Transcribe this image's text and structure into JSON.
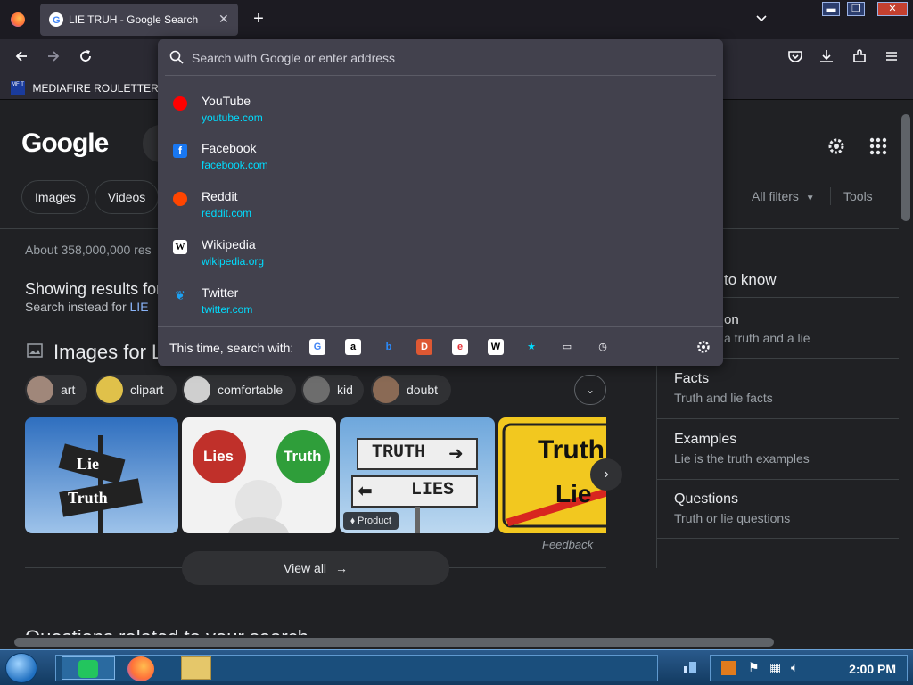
{
  "browser": {
    "tab_title": "LIE TRUH - Google Search",
    "new_tab": "+",
    "tab_close": "✕",
    "list_tabs": "⌄",
    "bookmark": "MEDIAFIRE ROULETTER",
    "bookmark_badge": "MF T"
  },
  "urlbar": {
    "placeholder": "Search with Google or enter address",
    "suggestions": [
      {
        "name": "YouTube",
        "url": "youtube.com",
        "icon": "youtube-icon",
        "color": "#ff0000"
      },
      {
        "name": "Facebook",
        "url": "facebook.com",
        "icon": "facebook-icon",
        "color": "#1877f2"
      },
      {
        "name": "Reddit",
        "url": "reddit.com",
        "icon": "reddit-icon",
        "color": "#ff4500"
      },
      {
        "name": "Wikipedia",
        "url": "wikipedia.org",
        "icon": "wikipedia-icon",
        "color": "#ffffff"
      },
      {
        "name": "Twitter",
        "url": "twitter.com",
        "icon": "twitter-icon",
        "color": "#1da1f2"
      }
    ],
    "search_with_label": "This time, search with:",
    "engines": [
      {
        "name": "google-engine-icon",
        "glyph": "G",
        "bg": "#ffffff",
        "fg": "#4285f4"
      },
      {
        "name": "amazon-engine-icon",
        "glyph": "a",
        "bg": "#ffffff",
        "fg": "#000000"
      },
      {
        "name": "bing-engine-icon",
        "glyph": "b",
        "bg": "#42414d",
        "fg": "#2a8cff"
      },
      {
        "name": "duckduckgo-engine-icon",
        "glyph": "D",
        "bg": "#de5833",
        "fg": "#ffffff"
      },
      {
        "name": "ebay-engine-icon",
        "glyph": "e",
        "bg": "#ffffff",
        "fg": "#e53238"
      },
      {
        "name": "wikipedia-engine-icon",
        "glyph": "W",
        "bg": "#ffffff",
        "fg": "#000000"
      },
      {
        "name": "bookmarks-engine-icon",
        "glyph": "★",
        "bg": "#42414d",
        "fg": "#00ddff"
      },
      {
        "name": "tabs-engine-icon",
        "glyph": "▭",
        "bg": "#42414d",
        "fg": "#fbfbfe"
      },
      {
        "name": "history-engine-icon",
        "glyph": "◷",
        "bg": "#42414d",
        "fg": "#fbfbfe"
      }
    ]
  },
  "page": {
    "logo": "Google",
    "chips": [
      "Images",
      "Videos"
    ],
    "all_filters": "All filters",
    "tools": "Tools",
    "result_count": "About 358,000,000 res",
    "showing": "Showing results for",
    "instead_prefix": "Search instead for",
    "instead_link": "LIE",
    "images_title": "Images for L",
    "pills": [
      "art",
      "clipart",
      "comfortable",
      "kid",
      "doubt"
    ],
    "image_badge": "Product",
    "feedback": "Feedback",
    "view_all": "View all",
    "questions_heading": "Questions related to your search",
    "right_panel": {
      "header": "to know",
      "partial_title": "on",
      "partial_sub": "a truth and a lie",
      "items": [
        {
          "title": "Facts",
          "sub": "Truth and lie facts"
        },
        {
          "title": "Examples",
          "sub": "Lie is the truth examples"
        },
        {
          "title": "Questions",
          "sub": "Truth or lie questions"
        }
      ]
    },
    "image_texts": {
      "img1_top": "Lie",
      "img1_bottom": "Truth",
      "img2_left": "Lies",
      "img2_right": "Truth",
      "img3_top": "TRUTH",
      "img3_bottom": "LIES",
      "img4_top": "Truth",
      "img4_bottom": "Lie"
    }
  },
  "taskbar": {
    "clock": "2:00 PM"
  }
}
